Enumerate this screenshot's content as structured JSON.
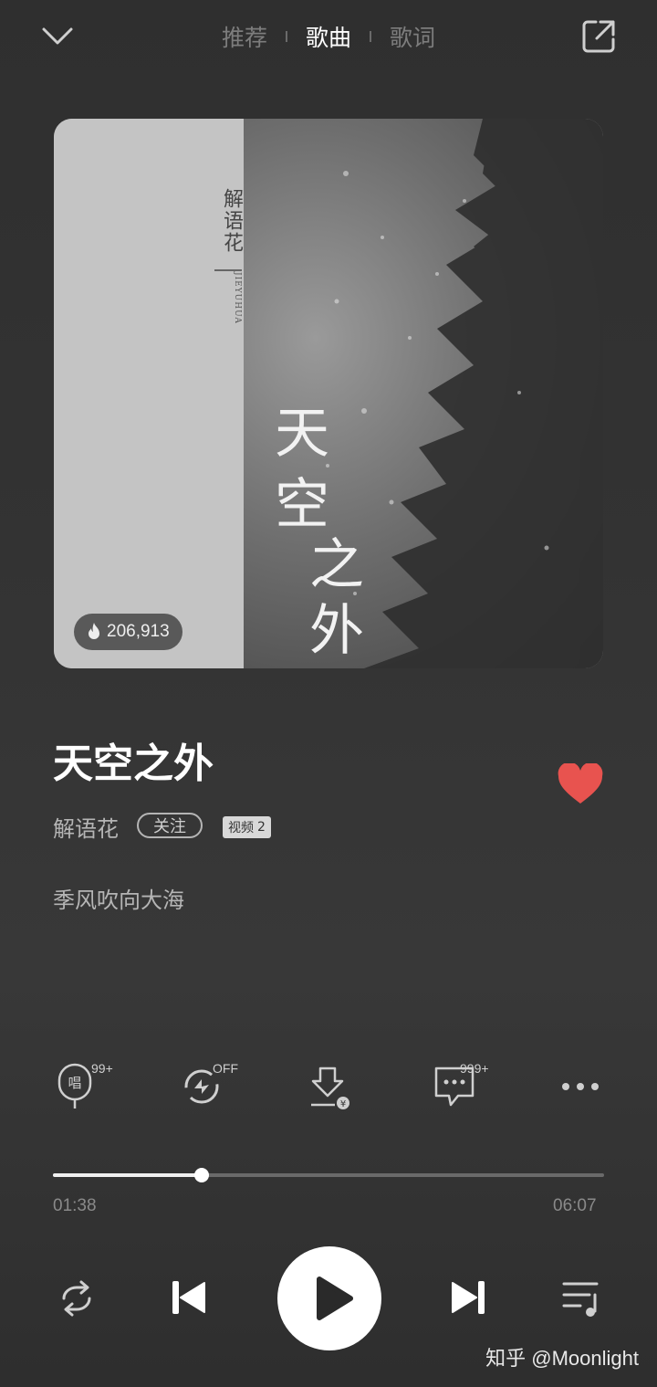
{
  "header": {
    "tabs": [
      {
        "label": "推荐",
        "active": false
      },
      {
        "label": "歌曲",
        "active": true
      },
      {
        "label": "歌词",
        "active": false
      }
    ],
    "icons": {
      "collapse": "chevron-down-icon",
      "share": "share-external-icon"
    }
  },
  "cover": {
    "small_title": "解语花",
    "romaji": "JIEYUHUA",
    "big_title_chars": [
      "天",
      "空",
      "之",
      "外"
    ],
    "play_count": "206,913",
    "play_count_icon": "flame-icon"
  },
  "song": {
    "title": "天空之外",
    "artist": "解语花",
    "follow_label": "关注",
    "video_label": "视频",
    "video_count": "2",
    "album": "季风吹向大海",
    "liked": true,
    "like_color": "#e8534f"
  },
  "actions": [
    {
      "name": "sing-button",
      "icon": "microphone-icon",
      "badge": "99+"
    },
    {
      "name": "effect-button",
      "icon": "sound-effect-icon",
      "badge": "OFF"
    },
    {
      "name": "download-button",
      "icon": "download-paid-icon",
      "badge": ""
    },
    {
      "name": "comment-button",
      "icon": "comment-icon",
      "badge": "999+"
    },
    {
      "name": "more-button",
      "icon": "more-icon",
      "badge": ""
    }
  ],
  "progress": {
    "current": "01:38",
    "total": "06:07",
    "fraction": 0.27
  },
  "controls": {
    "repeat": "repeat-icon",
    "prev": "previous-icon",
    "play": "play-icon",
    "next": "next-icon",
    "playlist": "playlist-icon"
  },
  "watermark": "知乎 @Moonlight"
}
